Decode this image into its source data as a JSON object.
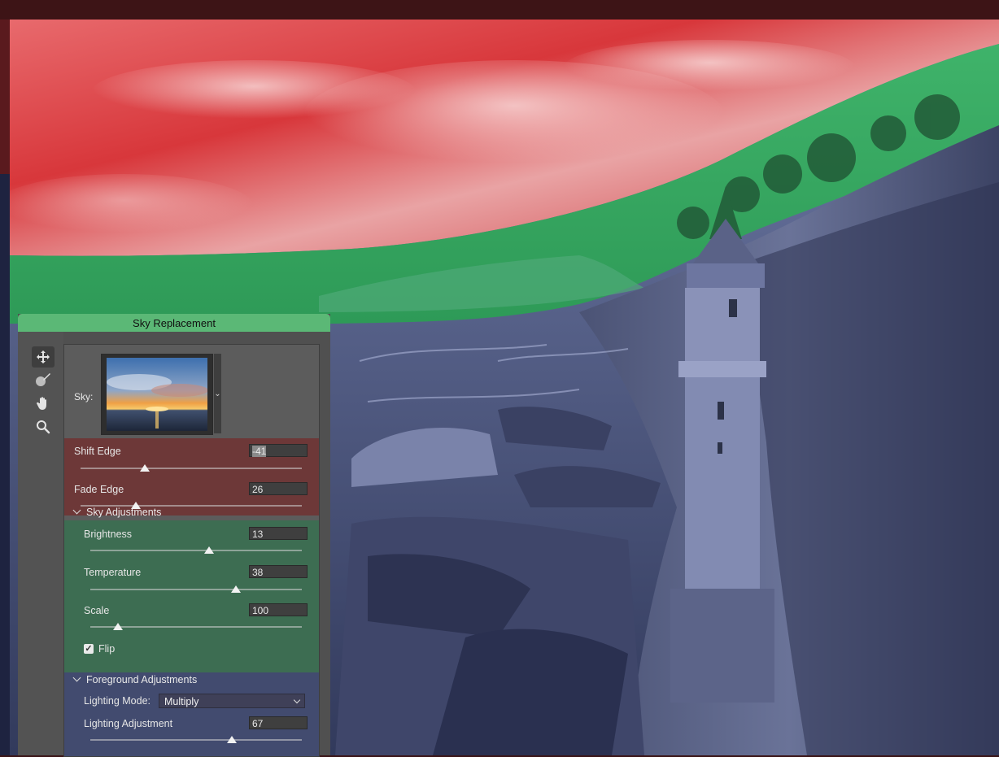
{
  "panel": {
    "title": "Sky Replacement"
  },
  "tools": [
    {
      "name": "move-tool-icon",
      "active": true
    },
    {
      "name": "sky-brush-tool-icon",
      "active": false
    },
    {
      "name": "hand-tool-icon",
      "active": false
    },
    {
      "name": "zoom-tool-icon",
      "active": false
    }
  ],
  "sky": {
    "label": "Sky:"
  },
  "edge": {
    "shift_label": "Shift Edge",
    "shift_value": "-41",
    "shift_slider": 0.29,
    "fade_label": "Fade Edge",
    "fade_value": "26",
    "fade_slider": 0.25
  },
  "sky_adjustments": {
    "title": "Sky Adjustments",
    "brightness_label": "Brightness",
    "brightness_value": "13",
    "brightness_slider": 0.56,
    "temperature_label": "Temperature",
    "temperature_value": "38",
    "temperature_slider": 0.69,
    "scale_label": "Scale",
    "scale_value": "100",
    "scale_slider": 0.13,
    "flip_label": "Flip",
    "flip_checked": true
  },
  "foreground_adjustments": {
    "title": "Foreground Adjustments",
    "lighting_mode_label": "Lighting Mode:",
    "lighting_mode_value": "Multiply",
    "lighting_adjustment_label": "Lighting Adjustment",
    "lighting_adjustment_value": "67",
    "lighting_adjustment_slider": 0.67
  },
  "colors": {
    "sky_mask": "#d8373b",
    "edge_mask": "#3fb36a",
    "foreground_tint": "#5b638f",
    "panel_title_bar": "#5bb876",
    "edge_section": "#6d3838",
    "sky_section": "#3d6d52",
    "foreground_section": "#424b6f"
  }
}
